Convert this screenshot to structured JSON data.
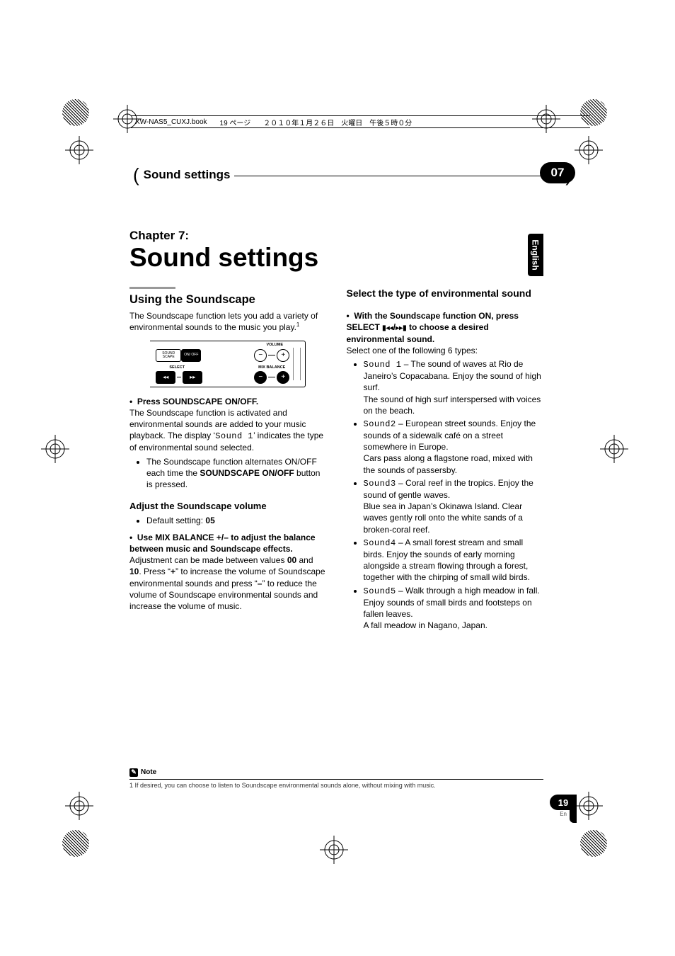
{
  "fileinfo": {
    "filename": "XW-NAS5_CUXJ.book",
    "pagepart": "19 ページ",
    "datepart": "２０１０年１月２６日　火曜日　午後５時０分"
  },
  "runhead": {
    "title": "Sound settings"
  },
  "chapnum_badge": "07",
  "sidetab": "English",
  "chapter": {
    "num": "Chapter 7:",
    "title": "Sound settings"
  },
  "left": {
    "h2": "Using the Soundscape",
    "intro": "The Soundscape function lets you add a variety of environmental sounds to the music you play.",
    "intro_sup": "1",
    "remote": {
      "lbl_soundscape": "SOUND SCAPE",
      "lbl_onoff": "ON/ OFF",
      "lbl_volume": "VOLUME",
      "lbl_select": "SELECT",
      "lbl_mixbalance": "MIX BALANCE",
      "minus": "−",
      "plus": "+"
    },
    "step1_lead": "Press SOUNDSCAPE ON/OFF.",
    "step1_body_a": "The Soundscape function is activated and environmental sounds are added to your music playback. The display ‘",
    "step1_seg": "Sound 1",
    "step1_body_b": "’ indicates the type of environmental sound selected.",
    "step1_sub": "The Soundscape function alternates ON/OFF each time the ",
    "step1_sub_b": "SOUNDSCAPE ON/OFF",
    "step1_sub_c": " button is pressed.",
    "h3a": "Adjust the Soundscape volume",
    "default_label": "Default setting: ",
    "default_value": "05",
    "mix_lead": "Use MIX BALANCE +/– to adjust the balance between music and Soundscape effects.",
    "mix_body_a": "Adjustment can be made between values ",
    "mix_v0": "00",
    "mix_body_b": " and ",
    "mix_v1": "10",
    "mix_body_c": ". Press “",
    "mix_plus": "+",
    "mix_body_d": "” to increase the volume of Soundscape environmental sounds and press “",
    "mix_minus": "–",
    "mix_body_e": "” to reduce the volume of Soundscape environmental sounds and increase the volume of music."
  },
  "right": {
    "h3": "Select the type of environmental sound",
    "lead_a": "With the Soundscape function ON, press SELECT ",
    "lead_b": " to choose a desired environmental sound.",
    "select_intro": "Select one of the following 6 types:",
    "items": [
      {
        "seg": "Sound 1",
        "t1": " – The sound of waves at Rio de Janeiro’s Copacabana. Enjoy the sound of high surf.",
        "t2": "The sound of high surf interspersed with voices on the beach."
      },
      {
        "seg": "Sound2",
        "t1": " – European street sounds. Enjoy the sounds of a sidewalk café on a street somewhere in Europe.",
        "t2": "Cars pass along a flagstone road, mixed with the sounds of passersby."
      },
      {
        "seg": "Sound3",
        "t1": " – Coral reef in the tropics. Enjoy the sound of gentle waves.",
        "t2": "Blue sea in Japan’s Okinawa Island. Clear waves gently roll onto the white sands of a broken-coral reef."
      },
      {
        "seg": "Sound4",
        "t1": " – A small forest stream and small birds. Enjoy the sounds of early morning alongside a stream flowing through a forest, together with the chirping of small wild birds.",
        "t2": ""
      },
      {
        "seg": "Sound5",
        "t1": " – Walk through a high meadow in fall. Enjoy sounds of small birds and footsteps on fallen leaves.",
        "t2": "A fall meadow in Nagano, Japan."
      }
    ]
  },
  "note": {
    "label": "Note",
    "text": "1 If desired, you can choose to listen to Soundscape environmental sounds alone, without mixing with music."
  },
  "pagenum": {
    "num": "19",
    "lang": "En"
  }
}
